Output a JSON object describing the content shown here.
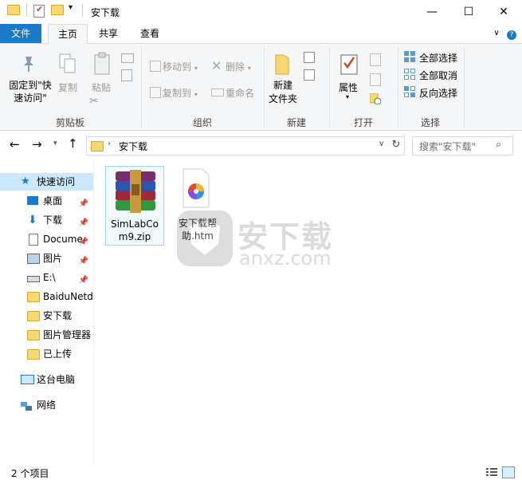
{
  "window": {
    "title": "安下载",
    "minimize_glyph": "—",
    "maximize_glyph": "☐",
    "close_glyph": "✕"
  },
  "tabs": {
    "file": "文件",
    "home": "主页",
    "share": "共享",
    "view": "查看"
  },
  "ribbon": {
    "clipboard": {
      "label": "剪贴板",
      "pin_quick_access_line1": "固定到\"快",
      "pin_quick_access_line2": "速访问\"",
      "copy": "复制",
      "paste": "粘贴"
    },
    "organize": {
      "label": "组织",
      "move_to": "移动到",
      "copy_to": "复制到",
      "delete": "删除",
      "rename": "重命名"
    },
    "new": {
      "label": "新建",
      "new_folder_line1": "新建",
      "new_folder_line2": "文件夹"
    },
    "open": {
      "label": "打开",
      "properties": "属性"
    },
    "select": {
      "label": "选择",
      "select_all": "全部选择",
      "select_none": "全部取消",
      "invert_selection": "反向选择"
    }
  },
  "address": {
    "path": "安下载",
    "search_placeholder": "搜索\"安下载\""
  },
  "nav": {
    "quick_access": "快速访问",
    "desktop": "桌面",
    "downloads": "下载",
    "documents": "Docume",
    "pictures": "图片",
    "e_drive": "E:\\",
    "baidunet": "BaiduNetd",
    "anxiazai": "安下载",
    "pic_manager": "图片管理器",
    "uploaded": "已上传",
    "this_pc": "这台电脑",
    "network": "网络"
  },
  "files": [
    {
      "name_line1": "SimLabCo",
      "name_line2": "m9.zip"
    },
    {
      "name_line1": "安下载帮",
      "name_line2": "助.htm"
    }
  ],
  "watermark": {
    "cn": "安下载",
    "en": "anxz.com"
  },
  "status": {
    "count": "2 个项目"
  }
}
